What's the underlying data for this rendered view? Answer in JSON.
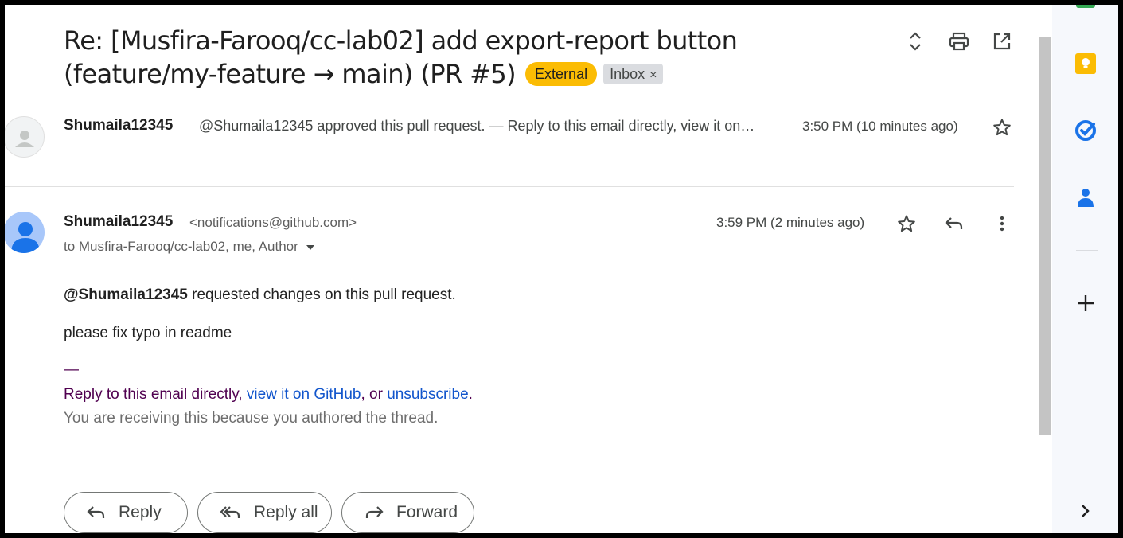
{
  "thread": {
    "subject": "Re: [Musfira-Farooq/cc-lab02] add export-report button (feature/my-feature → main) (PR #5)",
    "labels": {
      "external": "External",
      "inbox": "Inbox",
      "inbox_remove": "×"
    }
  },
  "collapsed_message": {
    "sender": "Shumaila12345",
    "snippet": "@Shumaila12345 approved this pull request. — Reply to this email directly, view it on…",
    "time": "3:50 PM (10 minutes ago)"
  },
  "open_message": {
    "sender": "Shumaila12345",
    "email": "<notifications@github.com>",
    "to": "to Musfira-Farooq/cc-lab02, me, Author",
    "time": "3:59 PM (2 minutes ago)",
    "body": {
      "mention": "@Shumaila12345",
      "line1_rest": " requested changes on this pull request.",
      "line2": "please fix typo in readme",
      "sig_dash": "—",
      "reply_prefix": "Reply to this email directly, ",
      "view_link": "view it on GitHub",
      "reply_mid": ", or ",
      "unsubscribe_link": "unsubscribe",
      "reply_end": ".",
      "receiving": "You are receiving this because you authored the thread."
    }
  },
  "actions": {
    "reply": "Reply",
    "reply_all": "Reply all",
    "forward": "Forward"
  },
  "colors": {
    "external_label": "#fbbc04",
    "link": "#1155cc",
    "signature": "#500050",
    "keep": "#fbbc04",
    "tasks": "#1a73e8",
    "contacts": "#1a73e8"
  },
  "icons": [
    "expand-collapse-icon",
    "print-icon",
    "open-in-new-window-icon",
    "star-icon",
    "reply-icon",
    "more-vert-icon",
    "keep-icon",
    "tasks-icon",
    "contacts-icon",
    "add-icon",
    "chevron-right-icon"
  ]
}
